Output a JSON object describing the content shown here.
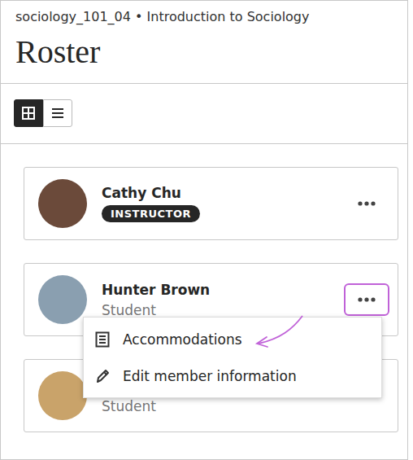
{
  "header": {
    "course": "sociology_101_04 • Introduction to Sociology",
    "title": "Roster"
  },
  "view_toggle": [
    {
      "kind": "grid",
      "selected": true
    },
    {
      "kind": "list",
      "selected": false
    }
  ],
  "members": [
    {
      "name": "Cathy Chu",
      "role": "INSTRUCTOR",
      "kind": "badge",
      "highlighted": false,
      "menu_open": false
    },
    {
      "name": "Hunter Brown",
      "role": "Student",
      "kind": "plain",
      "highlighted": true,
      "menu_open": true
    },
    {
      "name": "",
      "role": "Student",
      "kind": "plain",
      "highlighted": false,
      "menu_open": false
    }
  ],
  "menu": {
    "items": [
      {
        "label": "Accommodations",
        "kind": "document"
      },
      {
        "label": "Edit member information",
        "kind": "pencil"
      }
    ]
  },
  "annotation": {
    "kind": "arrow",
    "target": "Accommodations"
  }
}
